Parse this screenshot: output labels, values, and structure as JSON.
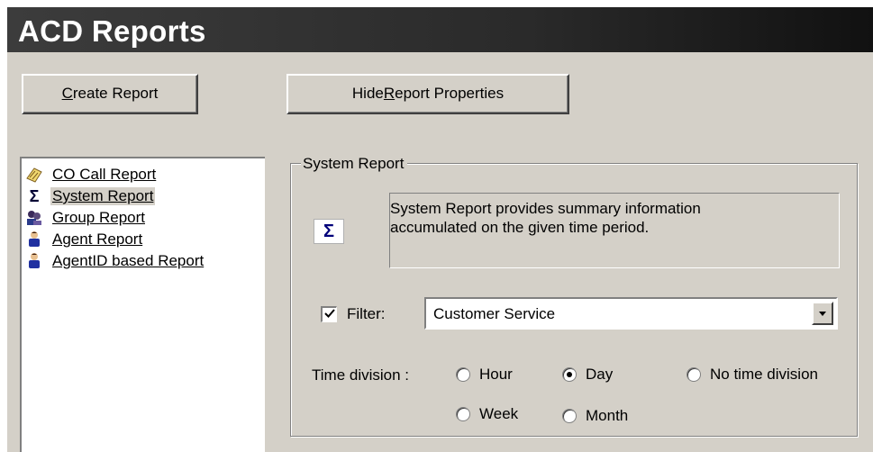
{
  "app": {
    "title": "ACD Reports"
  },
  "toolbar": {
    "create": {
      "accel": "C",
      "rest": "reate Report"
    },
    "hide": {
      "pre": "Hide ",
      "accel": "R",
      "rest": "eport Properties"
    }
  },
  "reports": [
    {
      "label": "CO Call Report",
      "icon": "phone-book-icon",
      "selected": false
    },
    {
      "label": "System Report",
      "icon": "sigma-icon",
      "selected": true
    },
    {
      "label": "Group Report",
      "icon": "group-icon",
      "selected": false
    },
    {
      "label": "Agent Report",
      "icon": "agent-icon",
      "selected": false
    },
    {
      "label": "AgentID based Report",
      "icon": "agent-id-icon",
      "selected": false
    }
  ],
  "properties": {
    "group_title": "System Report",
    "description_line1": "System Report provides summary information",
    "description_line2": "accumulated on the given time period.",
    "filter": {
      "checked": true,
      "label": "Filter:",
      "value": "Customer Service"
    },
    "time_division": {
      "label": "Time division :",
      "options": {
        "hour": "Hour",
        "day": "Day",
        "none": "No time division",
        "week": "Week",
        "month": "Month"
      },
      "selected": "Day"
    }
  },
  "colors": {
    "background": "#d4d0c8",
    "titlebar": "#2a2a2a",
    "sigma": "#00007a"
  }
}
